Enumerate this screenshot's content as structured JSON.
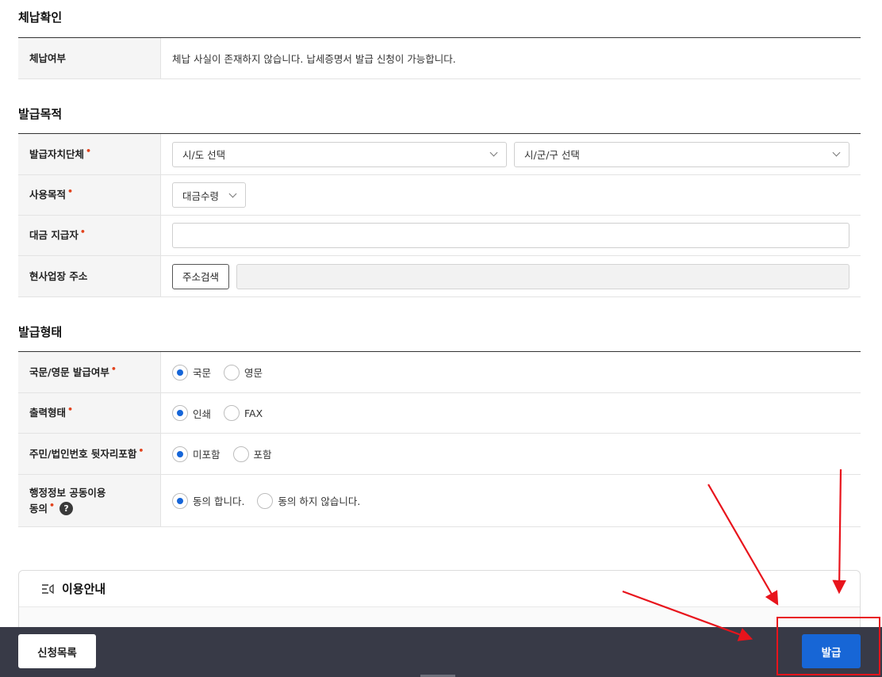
{
  "sections": {
    "arrears": {
      "title": "체납확인",
      "rows": [
        {
          "label": "체납여부",
          "value": "체납 사실이 존재하지 않습니다. 납세증명서 발급 신청이 가능합니다."
        }
      ]
    },
    "purpose": {
      "title": "발급목적",
      "rows": [
        {
          "label": "발급자치단체",
          "required": "•",
          "sido_select": "시/도 선택",
          "sigungu_select": "시/군/구 선택"
        },
        {
          "label": "사용목적",
          "required": "•",
          "select": "대금수령"
        },
        {
          "label": "대금 지급자",
          "required": "•",
          "input_value": ""
        },
        {
          "label": "현사업장 주소",
          "button": "주소검색",
          "input_value": ""
        }
      ]
    },
    "format": {
      "title": "발급형태",
      "rows": [
        {
          "label": "국문/영문 발급여부",
          "required": "•",
          "options": [
            "국문",
            "영문"
          ],
          "selected": "국문"
        },
        {
          "label": "출력형태",
          "required": "•",
          "options": [
            "인쇄",
            "FAX"
          ],
          "selected": "인쇄"
        },
        {
          "label": "주민/법인번호 뒷자리포함",
          "required": "•",
          "options": [
            "미포함",
            "포함"
          ],
          "selected": "미포함"
        },
        {
          "label_line1": "행정정보 공동이용",
          "label_line2": "동의",
          "required": "•",
          "help": "?",
          "options": [
            "동의 합니다.",
            "동의 하지 않습니다."
          ],
          "selected": "동의 합니다."
        }
      ]
    }
  },
  "guide": {
    "title": "이용안내",
    "icon": "notice-list-icon"
  },
  "bottom_bar": {
    "list_button": "신청목록",
    "issue_button": "발급"
  },
  "colors": {
    "accent": "#1766d6",
    "required": "#e2431e",
    "bottom_bar": "#383a47",
    "annotation": "#e8141c"
  }
}
